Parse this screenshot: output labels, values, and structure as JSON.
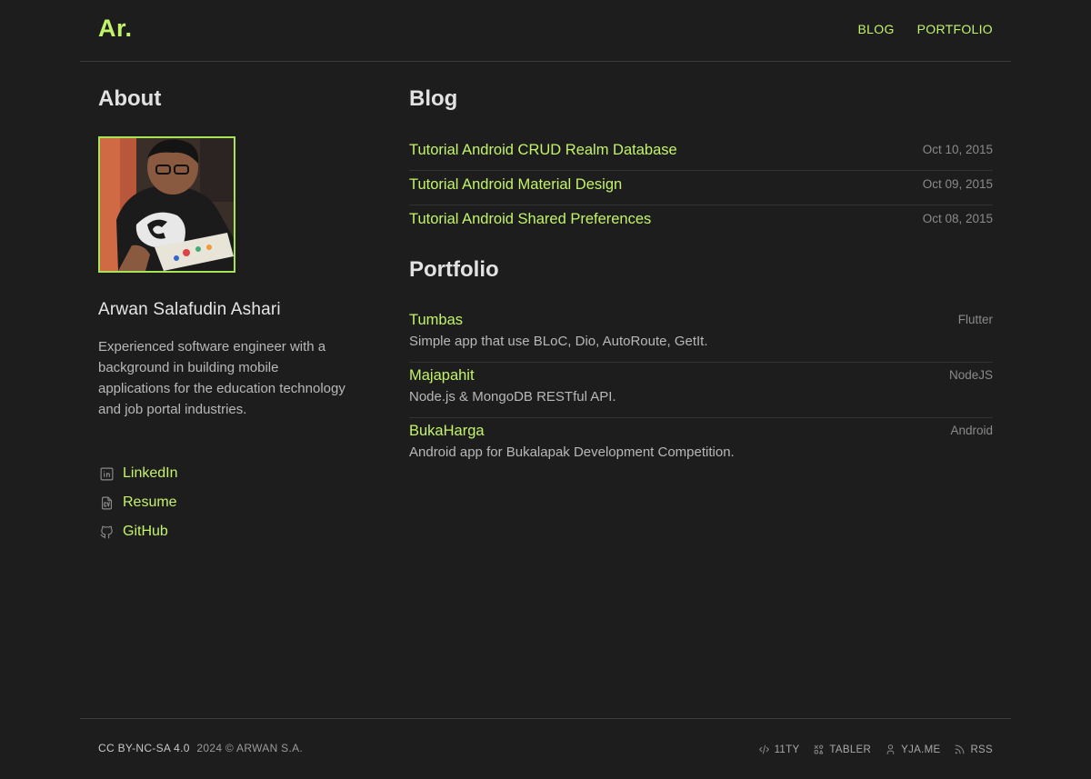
{
  "header": {
    "logo": "Ar.",
    "nav": [
      {
        "label": "BLOG"
      },
      {
        "label": "PORTFOLIO"
      }
    ]
  },
  "about": {
    "title": "About",
    "name": "Arwan Salafudin Ashari",
    "bio": "Experienced software engineer with a background in building mobile applications for the education technology and job portal industries.",
    "links": [
      {
        "label": "LinkedIn",
        "icon": "linkedin-icon"
      },
      {
        "label": "Resume",
        "icon": "cv-file-icon"
      },
      {
        "label": "GitHub",
        "icon": "github-icon"
      }
    ]
  },
  "blog": {
    "title": "Blog",
    "posts": [
      {
        "title": "Tutorial Android CRUD Realm Database",
        "date": "Oct 10, 2015"
      },
      {
        "title": "Tutorial Android Material Design",
        "date": "Oct 09, 2015"
      },
      {
        "title": "Tutorial Android Shared Preferences",
        "date": "Oct 08, 2015"
      }
    ]
  },
  "portfolio": {
    "title": "Portfolio",
    "items": [
      {
        "name": "Tumbas",
        "desc": "Simple app that use BLoC, Dio, AutoRoute, GetIt.",
        "tech": "Flutter"
      },
      {
        "name": "Majapahit",
        "desc": "Node.js & MongoDB RESTful API.",
        "tech": "NodeJS"
      },
      {
        "name": "BukaHarga",
        "desc": "Android app for Bukalapak Development Competition.",
        "tech": "Android"
      }
    ]
  },
  "footer": {
    "license": "CC BY-NC-SA 4.0",
    "copyright": "2024 © ARWAN S.A.",
    "links": [
      {
        "label": "11TY",
        "icon": "code-icon"
      },
      {
        "label": "TABLER",
        "icon": "shapes-icon"
      },
      {
        "label": "YJA.ME",
        "icon": "user-icon"
      },
      {
        "label": "RSS",
        "icon": "rss-icon"
      }
    ]
  },
  "colors": {
    "background": "#1d1d1d",
    "accent": "#c3f36b",
    "text": "#c9c9c9",
    "muted": "#8a8a8a"
  }
}
